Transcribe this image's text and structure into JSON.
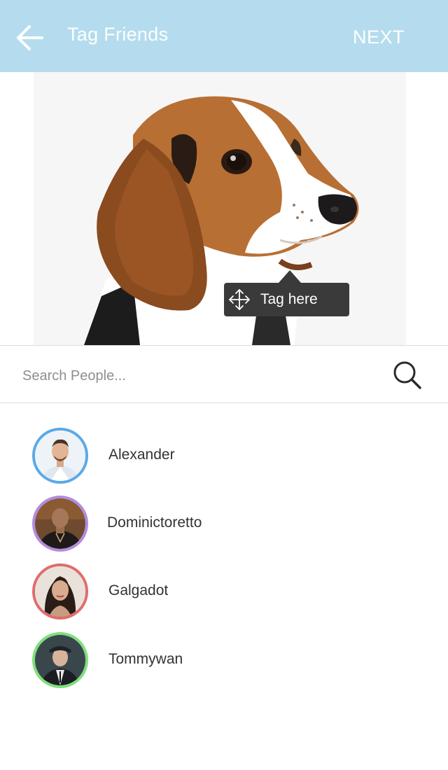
{
  "appbar": {
    "title": "Tag Friends",
    "next_label": "NEXT",
    "background": "#b4dcee"
  },
  "photo": {
    "subject": "beagle dog",
    "tag_hint": "Tag here"
  },
  "search": {
    "placeholder": "Search People...",
    "value": ""
  },
  "people": [
    {
      "name": "Alexander",
      "ring_color": "#5aa9e6"
    },
    {
      "name": "Dominictoretto",
      "ring_color": "#b38be0"
    },
    {
      "name": "Galgadot",
      "ring_color": "#e06c6c"
    },
    {
      "name": "Tommywan",
      "ring_color": "#7fe07a"
    }
  ],
  "icons": [
    "back-arrow-icon",
    "move-icon",
    "search-icon"
  ]
}
